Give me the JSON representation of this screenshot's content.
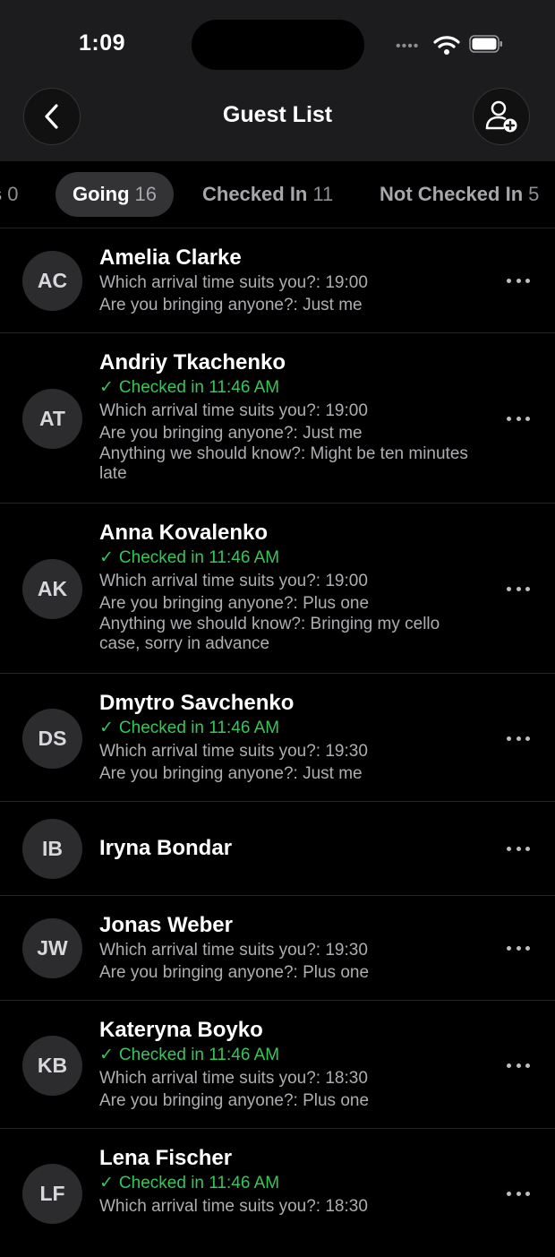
{
  "status": {
    "time": "1:09"
  },
  "header": {
    "title": "Guest List"
  },
  "icons": {
    "back": "chevron-left-icon",
    "add_guest": "add-person-icon",
    "more": "more-horizontal-icon",
    "check": "checkmark-icon"
  },
  "colors": {
    "accent_green": "#34c759",
    "background": "#000000",
    "topbar": "#1c1c1e"
  },
  "tabs": [
    {
      "label": "s",
      "count": "0"
    },
    {
      "label": "Going",
      "count": "16",
      "active": true
    },
    {
      "label": "Checked In",
      "count": "11"
    },
    {
      "label": "Not Checked In",
      "count": "5"
    }
  ],
  "guests": [
    {
      "initials": "AC",
      "name": "Amelia Clarke",
      "checked": "",
      "lines": [
        "Which arrival time suits you?: 19:00",
        "Are you bringing anyone?: Just me"
      ]
    },
    {
      "initials": "AT",
      "name": "Andriy Tkachenko",
      "checked": "Checked in 11:46 AM",
      "lines": [
        "Which arrival time suits you?: 19:00",
        "Are you bringing anyone?: Just me",
        "Anything we should know?: Might be ten minutes late"
      ]
    },
    {
      "initials": "AK",
      "name": "Anna Kovalenko",
      "checked": "Checked in 11:46 AM",
      "lines": [
        "Which arrival time suits you?: 19:00",
        "Are you bringing anyone?: Plus one",
        "Anything we should know?: Bringing my cello case, sorry in advance"
      ]
    },
    {
      "initials": "DS",
      "name": "Dmytro Savchenko",
      "checked": "Checked in 11:46 AM",
      "lines": [
        "Which arrival time suits you?: 19:30",
        "Are you bringing anyone?: Just me"
      ]
    },
    {
      "initials": "IB",
      "name": "Iryna Bondar",
      "checked": "",
      "lines": []
    },
    {
      "initials": "JW",
      "name": "Jonas Weber",
      "checked": "",
      "lines": [
        "Which arrival time suits you?: 19:30",
        "Are you bringing anyone?: Plus one"
      ]
    },
    {
      "initials": "KB",
      "name": "Kateryna Boyko",
      "checked": "Checked in 11:46 AM",
      "lines": [
        "Which arrival time suits you?: 18:30",
        "Are you bringing anyone?: Plus one"
      ]
    },
    {
      "initials": "LF",
      "name": "Lena Fischer",
      "checked": "Checked in 11:46 AM",
      "lines": [
        "Which arrival time suits you?: 18:30"
      ]
    }
  ]
}
